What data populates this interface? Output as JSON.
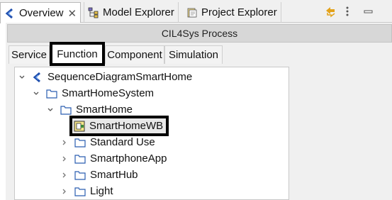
{
  "view_tabs": [
    {
      "label": "Overview",
      "icon": "cil4sys-logo-icon",
      "active": true,
      "closable": true
    },
    {
      "label": "Model Explorer",
      "icon": "model-explorer-icon",
      "active": false
    },
    {
      "label": "Project Explorer",
      "icon": "project-explorer-icon",
      "active": false
    }
  ],
  "toolbar": {
    "sync_icon": "sync-arrows-icon",
    "menu_icon": "view-menu-icon",
    "minimize_icon": "minimize-icon"
  },
  "process_title": "CIL4Sys Process",
  "sub_tabs": [
    {
      "label": "Service",
      "selected": false
    },
    {
      "label": "Function",
      "selected": true
    },
    {
      "label": "Component",
      "selected": false
    },
    {
      "label": "Simulation",
      "selected": false
    }
  ],
  "tree": [
    {
      "label": "SequenceDiagramSmartHome",
      "level": 0,
      "expanded": true,
      "icon": "cil4sys-logo-icon"
    },
    {
      "label": "SmartHomeSystem",
      "level": 1,
      "expanded": true,
      "icon": "folder-icon"
    },
    {
      "label": "SmartHome",
      "level": 2,
      "expanded": true,
      "icon": "folder-icon"
    },
    {
      "label": "SmartHomeWB",
      "level": 3,
      "expanded": null,
      "icon": "whitebox-icon",
      "highlighted": true
    },
    {
      "label": "Standard Use",
      "level": 3,
      "expanded": false,
      "icon": "folder-icon"
    },
    {
      "label": "SmartphoneApp",
      "level": 3,
      "expanded": false,
      "icon": "folder-icon"
    },
    {
      "label": "SmartHub",
      "level": 3,
      "expanded": false,
      "icon": "folder-icon"
    },
    {
      "label": "Light",
      "level": 3,
      "expanded": false,
      "icon": "folder-icon"
    }
  ],
  "colors": {
    "accent_blue": "#1f4fae",
    "folder_blue": "#2a5db0",
    "highlight_border": "#000000"
  }
}
